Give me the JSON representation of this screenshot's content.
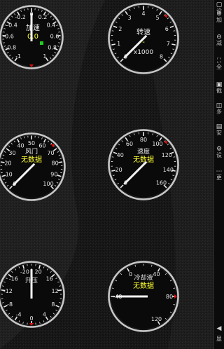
{
  "colors": {
    "background": "#151515",
    "gauge_face": "#0a0a0a",
    "bezel": "#c8c8c8",
    "tick": "#e8e8e8",
    "title_text": "#f0f0f0",
    "value_text": "#ffff33",
    "needle": "#f2f2f2",
    "needle_cap": "#dd1111",
    "indicator_green": "#22cc22"
  },
  "gauges": [
    {
      "id": "accel",
      "title": "加速",
      "value": "0.0",
      "units": "",
      "labels": [
        "-1",
        "-0.8",
        "-0.6",
        "-0.4",
        "-0.2",
        "0",
        "0.2",
        "0.4",
        "0.6",
        "0.8",
        "1"
      ],
      "needle_value_fraction": 0.5,
      "indicator": "green-square"
    },
    {
      "id": "rpm",
      "title": "转速",
      "value": "-",
      "units": "x1000",
      "labels": [
        "0",
        "1",
        "2",
        "3",
        "4",
        "5",
        "6",
        "7",
        "8"
      ],
      "needle_value_fraction": 0
    },
    {
      "id": "throttle",
      "title": "风门",
      "value": "无数据",
      "units": "",
      "labels": [
        "0",
        "10",
        "20",
        "30",
        "40",
        "50",
        "60",
        "70",
        "80",
        "90",
        "100"
      ],
      "needle_value_fraction": 0
    },
    {
      "id": "speed",
      "title": "速度",
      "value": "无数据",
      "units": "",
      "labels": [
        "0",
        "20",
        "40",
        "60",
        "80",
        "100",
        "120",
        "140",
        "160"
      ],
      "needle_value_fraction": 0
    },
    {
      "id": "boost",
      "title": "升压",
      "value": "-",
      "units": "",
      "labels": [
        "0",
        "-4",
        "-8",
        "-12",
        "-16",
        "-20",
        "20",
        "16",
        "12",
        "8",
        "4"
      ],
      "needle_value_fraction": 0.5
    },
    {
      "id": "coolant",
      "title": "冷却液",
      "value": "无数据",
      "units": "",
      "labels": [
        "-40",
        "0",
        "40",
        "80",
        "120"
      ],
      "needle_value_fraction": 0
    }
  ],
  "sidebar": {
    "items": [
      {
        "label": "设",
        "icon": "settings-icon"
      },
      {
        "label": "加",
        "icon": "add-icon"
      },
      {
        "label": "减",
        "icon": "remove-icon"
      },
      {
        "label": "全",
        "icon": "fullscreen-icon"
      },
      {
        "label": "截",
        "icon": "screenshot-icon"
      },
      {
        "label": "多",
        "icon": "multi-icon"
      },
      {
        "label": "安",
        "icon": "safe-icon"
      },
      {
        "label": "设",
        "icon": "gear-icon"
      },
      {
        "label": "更",
        "icon": "more-icon"
      }
    ],
    "bottom_arrow": "◀",
    "bottom_label": "显"
  }
}
